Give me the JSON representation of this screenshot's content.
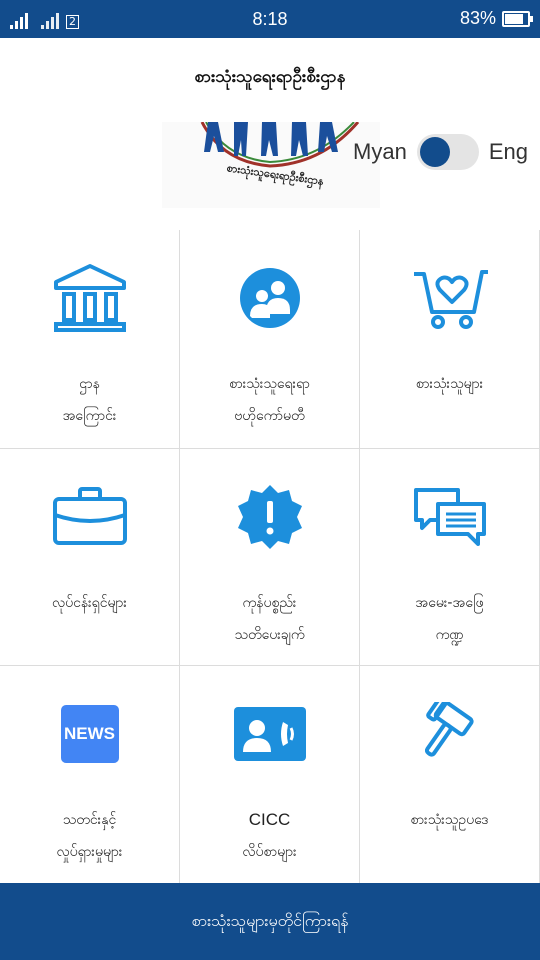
{
  "status_bar": {
    "sim_label": "2",
    "time": "8:18",
    "battery_text": "83%",
    "battery_level": 0.83
  },
  "header": {
    "title": "စားသုံးသူရေးရာဦးစီးဌာန",
    "logo_caption": "စားသုံးသူရေးရာဦးစီးဌာန"
  },
  "language": {
    "left": "Myan",
    "right": "Eng"
  },
  "grid": [
    {
      "icon": "institution-icon",
      "line1": "ဌာန",
      "line2": "အကြောင်း"
    },
    {
      "icon": "users-circle-icon",
      "line1": "စားသုံးသူရေးရာ",
      "line2": "ဗဟိုကော်မတီ"
    },
    {
      "icon": "heart-cart-icon",
      "line1": "စားသုံးသူများ",
      "line2": ""
    },
    {
      "icon": "briefcase-icon",
      "line1": "လုပ်ငန်းရှင်များ",
      "line2": ""
    },
    {
      "icon": "alert-badge-icon",
      "line1": "ကုန်ပစ္စည်း",
      "line2": "သတိပေးချက်"
    },
    {
      "icon": "chat-bubbles-icon",
      "line1": "အမေး-အဖြေ",
      "line2": "ကဏ္ဍ"
    },
    {
      "icon": "news-icon",
      "line1": "သတင်းနှင့်",
      "line2": "လှုပ်ရှားမှုများ",
      "icon_text": "NEWS"
    },
    {
      "icon": "contact-phone-icon",
      "line1": "CICC",
      "line2": "လိပ်စာများ"
    },
    {
      "icon": "gavel-icon",
      "line1": "စားသုံးသူဥပဒေ",
      "line2": ""
    }
  ],
  "bottom_bar": {
    "label": "စားသုံးသူများမှတိုင်ကြားရန်"
  },
  "colors": {
    "primary": "#124c8c",
    "icon_blue": "#1d8fdc",
    "news_bg": "#4285f4"
  }
}
